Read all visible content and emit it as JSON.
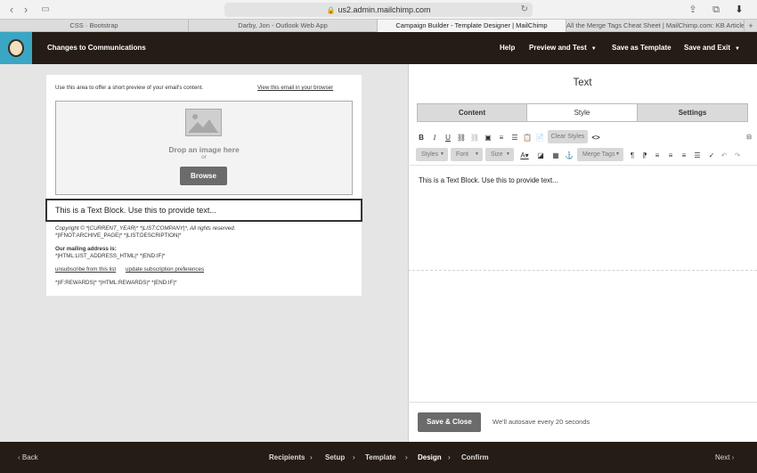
{
  "browser": {
    "url": "us2.admin.mailchimp.com",
    "tabs": [
      {
        "label": "CSS · Bootstrap",
        "active": false
      },
      {
        "label": "Darby, Jon - Outlook Web App",
        "active": false
      },
      {
        "label": "Campaign Builder - Template Designer | MailChimp",
        "active": true
      },
      {
        "label": "All the Merge Tags Cheat Sheet | MailChimp.com: KB Article",
        "active": false
      }
    ]
  },
  "header": {
    "title": "Changes to Communications",
    "help": "Help",
    "preview": "Preview and Test",
    "save_template": "Save as Template",
    "save_exit": "Save and Exit"
  },
  "preview": {
    "preheader_text": "Use this area to offer a short preview of your email's content.",
    "view_browser": "View this email in your browser",
    "drop_image": "Drop an image here",
    "or": "or",
    "browse": "Browse",
    "text_block": "This is a Text Block. Use this to provide text...",
    "footer": {
      "copyright": "Copyright © *|CURRENT_YEAR|* *|LIST:COMPANY|*, All rights reserved.",
      "archive": "*|IFNOT:ARCHIVE_PAGE|* *|LIST:DESCRIPTION|*",
      "mailing_label": "Our mailing address is:",
      "mailing_value": "*|HTML:LIST_ADDRESS_HTML|* *|END:IF|*",
      "unsubscribe": "unsubscribe from this list",
      "update_prefs": "update subscription preferences",
      "rewards": "*|IF:REWARDS|* *|HTML:REWARDS|* *|END:IF|*"
    }
  },
  "panel": {
    "title": "Text",
    "tabs": [
      "Content",
      "Style",
      "Settings"
    ],
    "selected_tab": "Style",
    "toolbar": {
      "clear_styles": "Clear Styles",
      "styles": "Styles",
      "font": "Font",
      "size": "Size",
      "merge_tags": "Merge Tags"
    },
    "editor_text": "This is a Text Block. Use this to provide text...",
    "save_close": "Save & Close",
    "autosave": "We'll autosave every 20 seconds"
  },
  "footer_nav": {
    "back": "Back",
    "steps": [
      "Recipients",
      "Setup",
      "Template",
      "Design",
      "Confirm"
    ],
    "current_step": "Design",
    "next": "Next"
  }
}
